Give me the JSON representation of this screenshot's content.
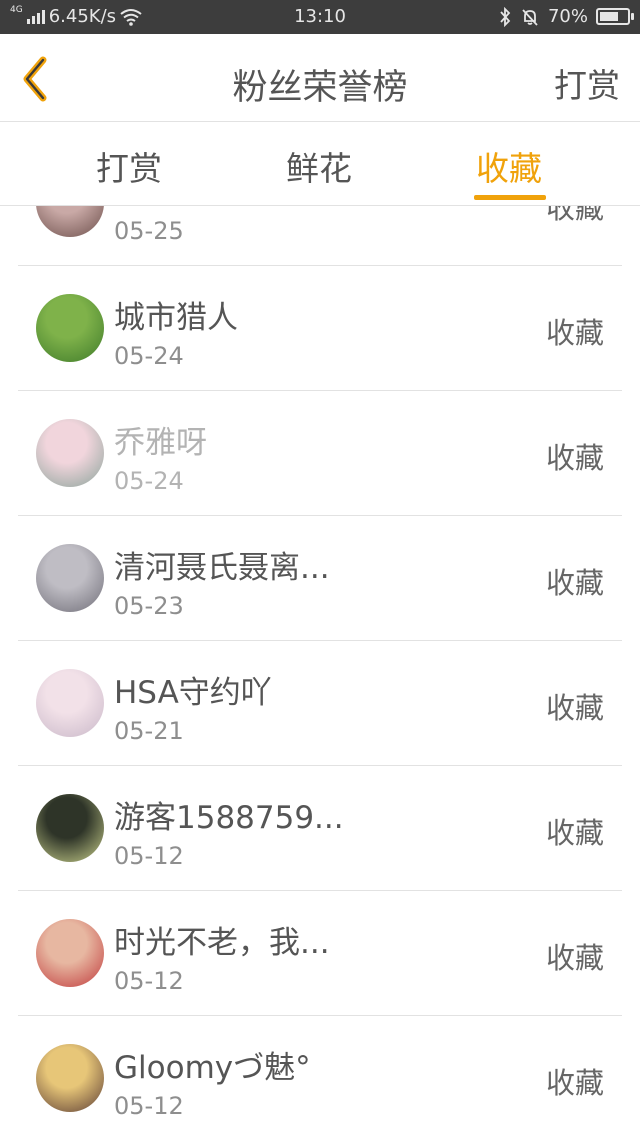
{
  "status_bar": {
    "network": "4G",
    "speed": "6.45K/s",
    "time": "13:10",
    "battery": "70%",
    "battery_level": 0.7
  },
  "header": {
    "title": "粉丝荣誉榜",
    "action": "打赏"
  },
  "tabs": [
    {
      "label": "打赏",
      "active": false
    },
    {
      "label": "鲜花",
      "active": false
    },
    {
      "label": "收藏",
      "active": true
    }
  ],
  "items": [
    {
      "name": "",
      "date": "05-25",
      "tag": "收藏",
      "avatar_colors": [
        "#c9a9a6",
        "#6b4e4a"
      ]
    },
    {
      "name": "城市猎人",
      "date": "05-24",
      "tag": "收藏",
      "avatar_colors": [
        "#7fb24a",
        "#3e7a2a"
      ]
    },
    {
      "name": "乔雅呀",
      "date": "05-24",
      "tag": "收藏",
      "avatar_colors": [
        "#f1d5dc",
        "#8aa39a"
      ]
    },
    {
      "name": "清河聂氏聂离...",
      "date": "05-23",
      "tag": "收藏",
      "avatar_colors": [
        "#bfbdc4",
        "#6f6d77"
      ]
    },
    {
      "name": "HSA守约吖",
      "date": "05-21",
      "tag": "收藏",
      "avatar_colors": [
        "#f2e1e8",
        "#c8b7c8"
      ]
    },
    {
      "name": "游客1588759...",
      "date": "05-12",
      "tag": "收藏",
      "avatar_colors": [
        "#2e3428",
        "#c9d08c"
      ]
    },
    {
      "name": "时光不老，我...",
      "date": "05-12",
      "tag": "收藏",
      "avatar_colors": [
        "#e7b7a1",
        "#c0393b"
      ]
    },
    {
      "name": "Gloomyづ魅°",
      "date": "05-12",
      "tag": "收藏",
      "avatar_colors": [
        "#e7c678",
        "#5a3b34"
      ]
    }
  ],
  "colors": {
    "accent": "#f0a20b",
    "text": "#555555",
    "subtext": "#8e8e8e",
    "divider": "#e2e2e2"
  }
}
